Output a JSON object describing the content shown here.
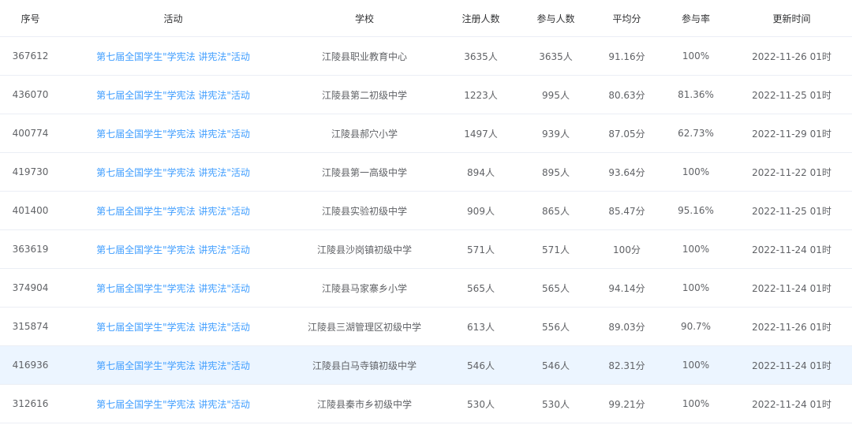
{
  "table": {
    "headers": [
      "序号",
      "活动",
      "学校",
      "注册人数",
      "参与人数",
      "平均分",
      "参与率",
      "更新时间"
    ],
    "highlight_color": "#ecf5ff",
    "link_color": "#409eff",
    "rows": [
      {
        "id": "367612",
        "activity": "第七届全国学生\"学宪法 讲宪法\"活动",
        "school": "江陵县职业教育中心",
        "registered": "3635人",
        "participants": "3635人",
        "avg_score": "91.16分",
        "rate": "100%",
        "updated": "2022-11-26 01时"
      },
      {
        "id": "436070",
        "activity": "第七届全国学生\"学宪法 讲宪法\"活动",
        "school": "江陵县第二初级中学",
        "registered": "1223人",
        "participants": "995人",
        "avg_score": "80.63分",
        "rate": "81.36%",
        "updated": "2022-11-25 01时"
      },
      {
        "id": "400774",
        "activity": "第七届全国学生\"学宪法 讲宪法\"活动",
        "school": "江陵县郝穴小学",
        "registered": "1497人",
        "participants": "939人",
        "avg_score": "87.05分",
        "rate": "62.73%",
        "updated": "2022-11-29 01时"
      },
      {
        "id": "419730",
        "activity": "第七届全国学生\"学宪法 讲宪法\"活动",
        "school": "江陵县第一高级中学",
        "registered": "894人",
        "participants": "895人",
        "avg_score": "93.64分",
        "rate": "100%",
        "updated": "2022-11-22 01时"
      },
      {
        "id": "401400",
        "activity": "第七届全国学生\"学宪法 讲宪法\"活动",
        "school": "江陵县实验初级中学",
        "registered": "909人",
        "participants": "865人",
        "avg_score": "85.47分",
        "rate": "95.16%",
        "updated": "2022-11-25 01时"
      },
      {
        "id": "363619",
        "activity": "第七届全国学生\"学宪法 讲宪法\"活动",
        "school": "江陵县沙岗镇初级中学",
        "registered": "571人",
        "participants": "571人",
        "avg_score": "100分",
        "rate": "100%",
        "updated": "2022-11-24 01时"
      },
      {
        "id": "374904",
        "activity": "第七届全国学生\"学宪法 讲宪法\"活动",
        "school": "江陵县马家寨乡小学",
        "registered": "565人",
        "participants": "565人",
        "avg_score": "94.14分",
        "rate": "100%",
        "updated": "2022-11-24 01时"
      },
      {
        "id": "315874",
        "activity": "第七届全国学生\"学宪法 讲宪法\"活动",
        "school": "江陵县三湖管理区初级中学",
        "registered": "613人",
        "participants": "556人",
        "avg_score": "89.03分",
        "rate": "90.7%",
        "updated": "2022-11-26 01时"
      },
      {
        "id": "416936",
        "activity": "第七届全国学生\"学宪法 讲宪法\"活动",
        "school": "江陵县白马寺镇初级中学",
        "registered": "546人",
        "participants": "546人",
        "avg_score": "82.31分",
        "rate": "100%",
        "updated": "2022-11-24 01时",
        "highlighted": true
      },
      {
        "id": "312616",
        "activity": "第七届全国学生\"学宪法 讲宪法\"活动",
        "school": "江陵县秦市乡初级中学",
        "registered": "530人",
        "participants": "530人",
        "avg_score": "99.21分",
        "rate": "100%",
        "updated": "2022-11-24 01时"
      }
    ]
  }
}
